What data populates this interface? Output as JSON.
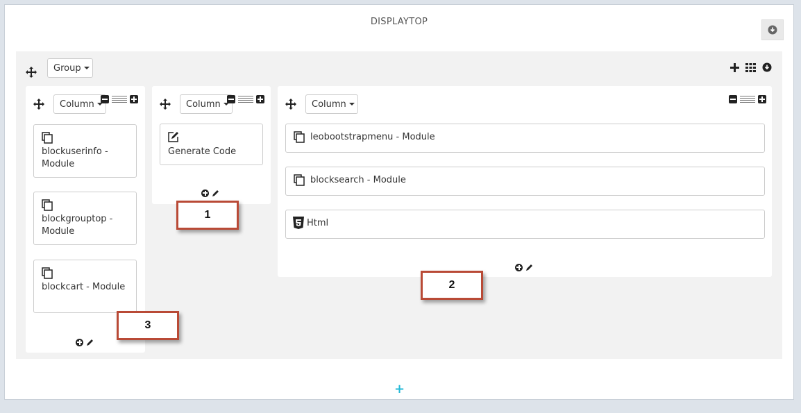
{
  "hook": {
    "title": "DISPLAYTOP"
  },
  "group": {
    "dropdown_label": "Group"
  },
  "columns": [
    {
      "dropdown_label": "Column",
      "items": [
        {
          "label": "blockuserinfo - Module"
        },
        {
          "label": "blockgrouptop - Module"
        },
        {
          "label": "blockcart - Module"
        }
      ]
    },
    {
      "dropdown_label": "Column",
      "items": [
        {
          "label": "Generate Code"
        }
      ]
    },
    {
      "dropdown_label": "Column",
      "items": [
        {
          "label": "leobootstrapmenu - Module"
        },
        {
          "label": "blocksearch - Module"
        },
        {
          "label": "Html"
        }
      ]
    }
  ],
  "callouts": [
    "1",
    "2",
    "3"
  ],
  "add_row_symbol": "+",
  "colors": {
    "accent": "#25b9d7",
    "callout_border": "#b94a36"
  }
}
